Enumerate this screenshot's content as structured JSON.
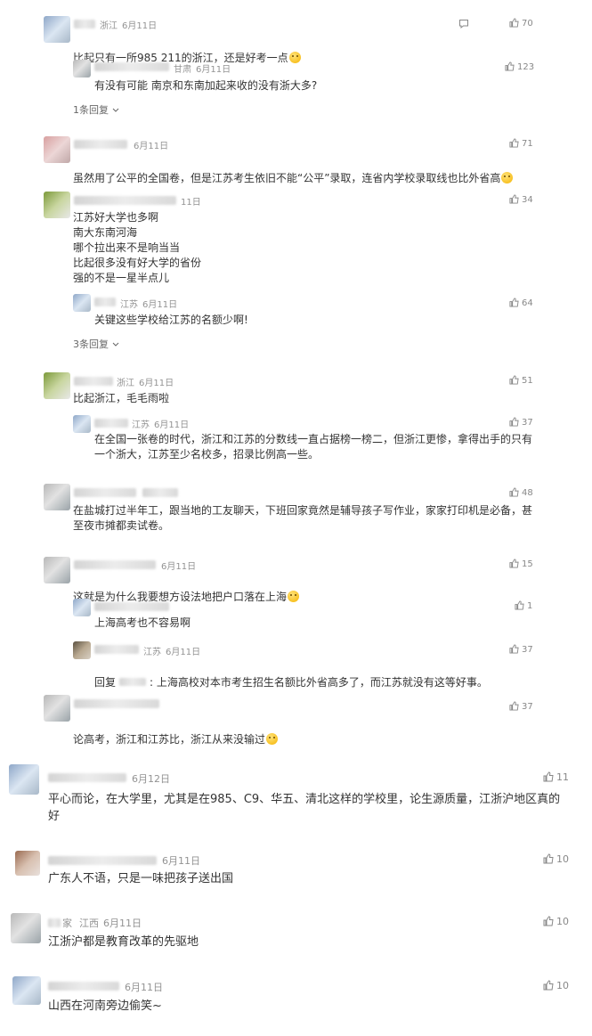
{
  "comments": [
    {
      "location": "浙江",
      "date": "6月11日",
      "likes": "70",
      "text": "比起只有一所985 211的浙江，还是好考一点",
      "replies": [
        {
          "location": "甘肃",
          "date": "6月11日",
          "likes": "123",
          "text": "有没有可能 南京和东南加起来收的没有浙大多?"
        }
      ],
      "more_replies": "1条回复"
    },
    {
      "location": "",
      "date": "6月11日",
      "likes": "71",
      "text": "虽然用了公平的全国卷，但是江苏考生依旧不能“公平”录取，连省内学校录取线也比外省高"
    },
    {
      "location": "",
      "date": "11日",
      "likes": "34",
      "text": "江苏好大学也多啊\n南大东南河海\n哪个拉出来不是响当当\n比起很多没有好大学的省份\n强的不是一星半点儿",
      "replies": [
        {
          "location": "江苏",
          "date": "6月11日",
          "likes": "64",
          "text": "关键这些学校给江苏的名额少啊!"
        }
      ],
      "more_replies": "3条回复"
    },
    {
      "location": "浙江",
      "date": "6月11日",
      "likes": "51",
      "text": "比起浙江，毛毛雨啦",
      "replies": [
        {
          "location": "江苏",
          "date": "6月11日",
          "likes": "37",
          "text": "在全国一张卷的时代，浙江和江苏的分数线一直占据榜一榜二，但浙江更惨，拿得出手的只有一个浙大，江苏至少名校多，招录比例高一些。"
        }
      ]
    },
    {
      "location": "",
      "date": "",
      "likes": "48",
      "text": "在盐城打过半年工，跟当地的工友聊天，下班回家竟然是辅导孩子写作业，家家打印机是必备，甚至夜市摊都卖试卷。"
    },
    {
      "location": "",
      "date": "6月11日",
      "likes": "15",
      "text": "这就是为什么我要想方设法地把户口落在上海",
      "replies": [
        {
          "location": "",
          "date": "",
          "likes": "1",
          "text": "上海高考也不容易啊"
        },
        {
          "location": "江苏",
          "date": "6月11日",
          "likes": "37",
          "reply_prefix": "回复",
          "text": ": 上海高校对本市考生招生名额比外省高多了，而江苏就没有这等好事。"
        }
      ]
    },
    {
      "location": "",
      "date": "",
      "likes": "37",
      "text": "论高考，浙江和江苏比，浙江从来没输过"
    },
    {
      "location": "",
      "date": "6月12日",
      "likes": "11",
      "text": "平心而论，在大学里，尤其是在985、C9、华五、清北这样的学校里，论生源质量，江浙沪地区真的好"
    },
    {
      "location": "",
      "date": "6月11日",
      "likes": "10",
      "text": "广东人不语，只是一味把孩子送出国"
    },
    {
      "location": "江西",
      "date": "6月11日",
      "likes": "10",
      "name_tail": "家",
      "text": "江浙沪都是教育改革的先驱地"
    },
    {
      "location": "",
      "date": "6月11日",
      "likes": "10",
      "text": "山西在河南旁边偷笑~"
    }
  ],
  "icons": {
    "message": "message-icon",
    "like": "thumbs-up-icon",
    "expand": "chevron-down-icon",
    "emoji": "emoji-icon"
  },
  "colors": {
    "text": "#333333",
    "meta": "#939393",
    "like": "#888888"
  }
}
